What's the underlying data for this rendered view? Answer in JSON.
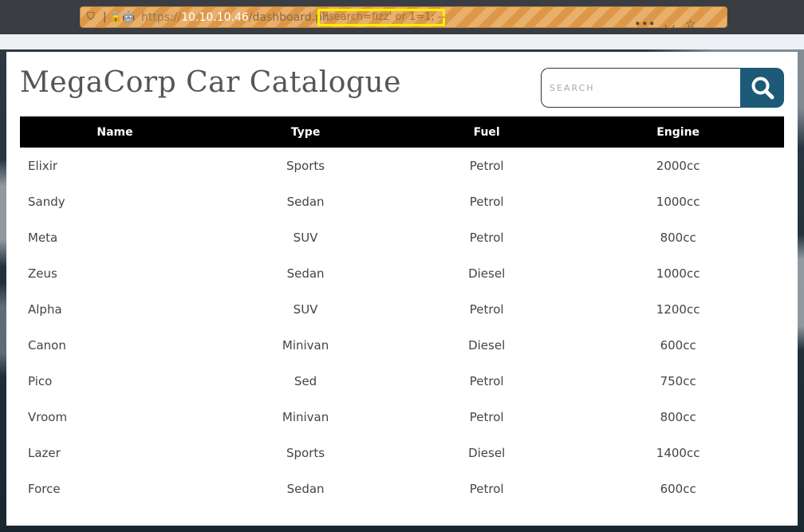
{
  "browser": {
    "url_scheme": "https://",
    "url_host": "10.10.10.46",
    "url_path": "/dashboard.ph",
    "url_highlighted_query": "?search=fizz' or 1=1; --",
    "more_icon": "ellipsis-icon",
    "pocket_icon": "pocket-icon",
    "bookmark_icon": "star-icon"
  },
  "page": {
    "title": "MegaCorp Car Catalogue",
    "search": {
      "placeholder": "SEARCH",
      "value": ""
    }
  },
  "table": {
    "headers": [
      "Name",
      "Type",
      "Fuel",
      "Engine"
    ],
    "rows": [
      [
        "Elixir",
        "Sports",
        "Petrol",
        "2000cc"
      ],
      [
        "Sandy",
        "Sedan",
        "Petrol",
        "1000cc"
      ],
      [
        "Meta",
        "SUV",
        "Petrol",
        "800cc"
      ],
      [
        "Zeus",
        "Sedan",
        "Diesel",
        "1000cc"
      ],
      [
        "Alpha",
        "SUV",
        "Petrol",
        "1200cc"
      ],
      [
        "Canon",
        "Minivan",
        "Diesel",
        "600cc"
      ],
      [
        "Pico",
        "Sed",
        "Petrol",
        "750cc"
      ],
      [
        "Vroom",
        "Minivan",
        "Petrol",
        "800cc"
      ],
      [
        "Lazer",
        "Sports",
        "Diesel",
        "1400cc"
      ],
      [
        "Force",
        "Sedan",
        "Petrol",
        "600cc"
      ]
    ]
  },
  "colors": {
    "header_bg": "#000000",
    "search_button": "#1c5a78",
    "highlight_box": "#ffee00"
  }
}
